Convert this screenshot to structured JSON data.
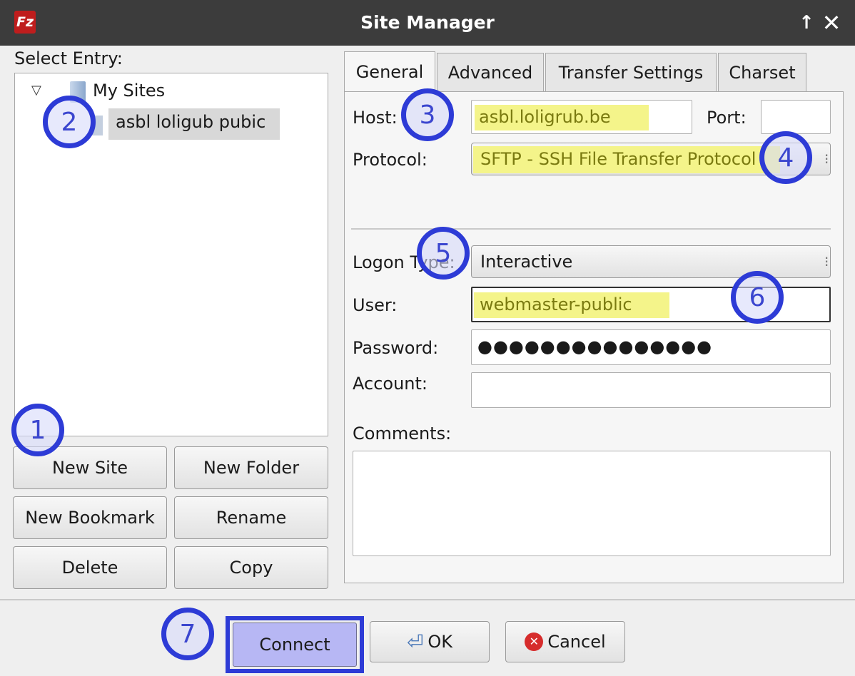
{
  "window": {
    "title": "Site Manager",
    "app_icon_text": "Fz"
  },
  "left": {
    "select_label": "Select Entry:",
    "tree": {
      "root": "My Sites",
      "site": "asbl loligub pubic"
    },
    "buttons": {
      "new_site": "New Site",
      "new_folder": "New Folder",
      "new_bookmark": "New Bookmark",
      "rename": "Rename",
      "delete": "Delete",
      "copy": "Copy"
    }
  },
  "tabs": [
    "General",
    "Advanced",
    "Transfer Settings",
    "Charset"
  ],
  "general": {
    "host_label": "Host:",
    "host_value": "asbl.loligrub.be",
    "port_label": "Port:",
    "port_value": "",
    "protocol_label": "Protocol:",
    "protocol_value": "SFTP - SSH File Transfer Protocol",
    "logon_label": "Logon Type:",
    "logon_value": "Interactive",
    "user_label": "User:",
    "user_value": "webmaster-public",
    "password_label": "Password:",
    "password_value": "●●●●●●●●●●●●●●●",
    "account_label": "Account:",
    "account_value": "",
    "comments_label": "Comments:",
    "comments_value": ""
  },
  "footer": {
    "connect": "Connect",
    "ok": "OK",
    "cancel": "Cancel"
  },
  "callouts": [
    "1",
    "2",
    "3",
    "4",
    "5",
    "6",
    "7"
  ],
  "colors": {
    "callout": "#2d3bd6",
    "highlight": "#f4f48a",
    "connect_bg": "#b7b7f4"
  }
}
